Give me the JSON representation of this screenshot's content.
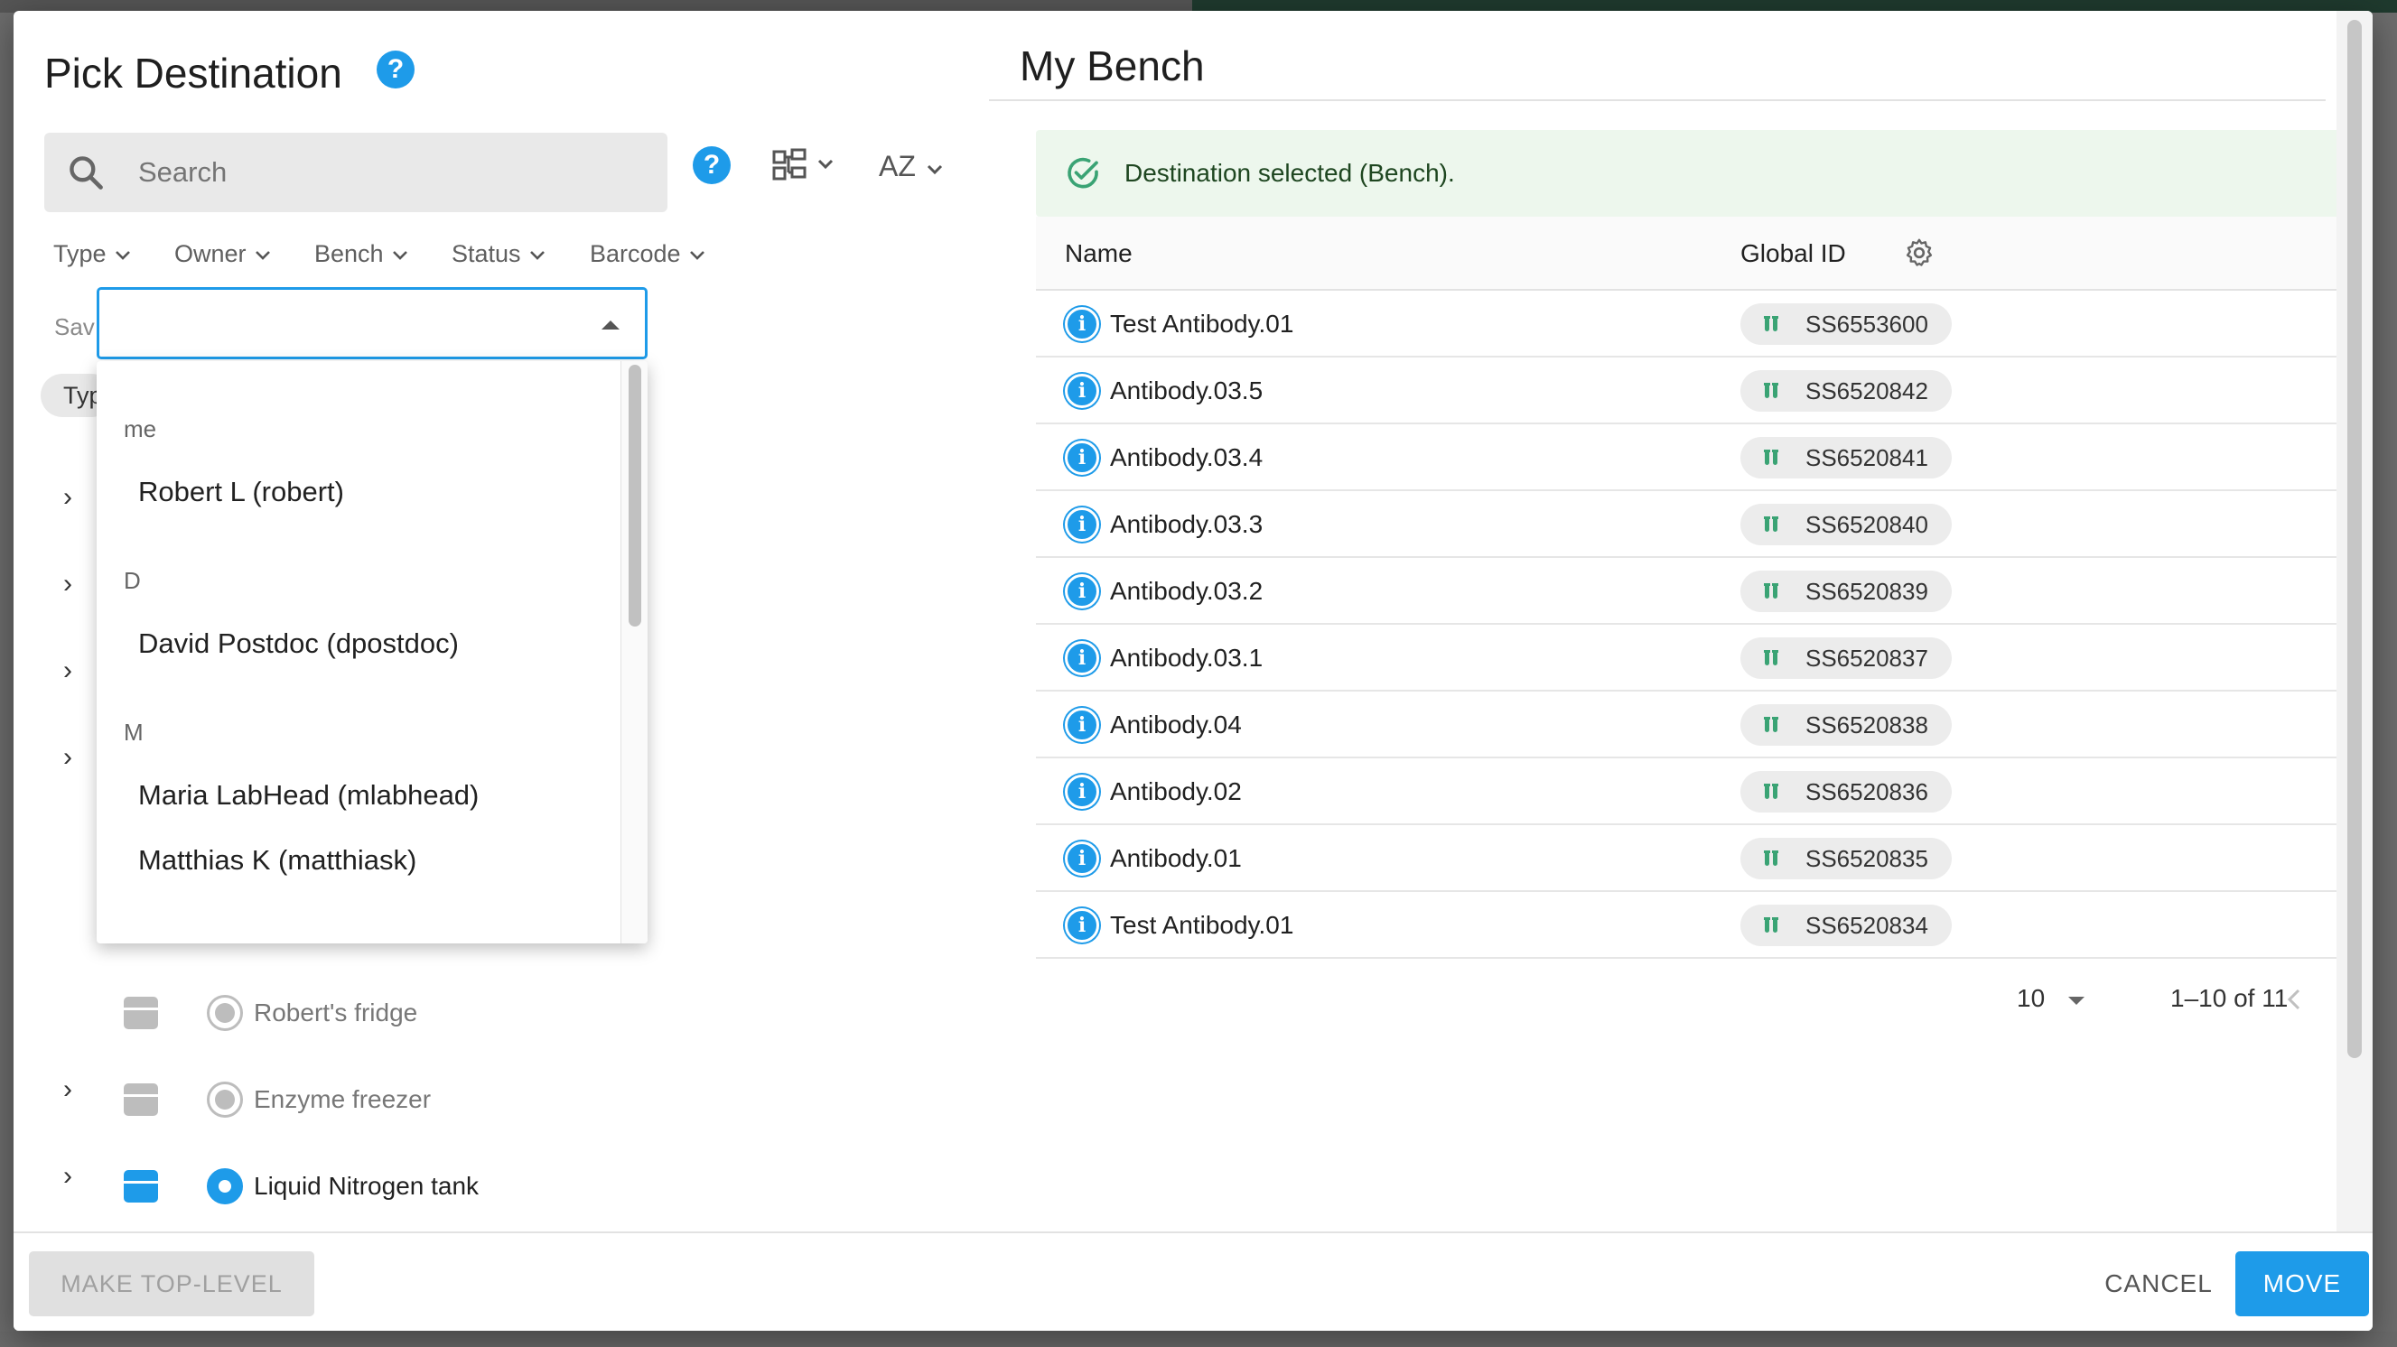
{
  "left": {
    "title": "Pick Destination",
    "help_glyph": "?",
    "search_placeholder": "Search",
    "sort_label": "AZ",
    "filters": [
      "Type",
      "Owner",
      "Bench",
      "Status",
      "Barcode"
    ],
    "saved_label": "Sav",
    "type_chip": "Typ",
    "tree": [
      {
        "label": "Robert's fridge",
        "expandable": false,
        "active": false
      },
      {
        "label": "Enzyme freezer",
        "expandable": true,
        "active": false
      },
      {
        "label": "Liquid Nitrogen tank",
        "expandable": true,
        "active": true
      }
    ]
  },
  "owner_dropdown": {
    "input_value": "",
    "groups": [
      {
        "header": "me",
        "items": [
          "Robert L (robert)"
        ]
      },
      {
        "header": "D",
        "items": [
          "David Postdoc (dpostdoc)"
        ]
      },
      {
        "header": "M",
        "items": [
          "Maria LabHead (mlabhead)",
          "Matthias K (matthiask)"
        ]
      }
    ]
  },
  "right": {
    "title": "My Bench",
    "alert": "Destination selected (Bench).",
    "columns": {
      "name": "Name",
      "global_id": "Global ID"
    },
    "rows": [
      {
        "name": "Test Antibody.01",
        "global_id": "SS6553600"
      },
      {
        "name": "Antibody.03.5",
        "global_id": "SS6520842"
      },
      {
        "name": "Antibody.03.4",
        "global_id": "SS6520841"
      },
      {
        "name": "Antibody.03.3",
        "global_id": "SS6520840"
      },
      {
        "name": "Antibody.03.2",
        "global_id": "SS6520839"
      },
      {
        "name": "Antibody.03.1",
        "global_id": "SS6520837"
      },
      {
        "name": "Antibody.04",
        "global_id": "SS6520838"
      },
      {
        "name": "Antibody.02",
        "global_id": "SS6520836"
      },
      {
        "name": "Antibody.01",
        "global_id": "SS6520835"
      },
      {
        "name": "Test Antibody.01",
        "global_id": "SS6520834"
      }
    ],
    "pager": {
      "rows_per_page": "10",
      "range": "1–10 of 11"
    }
  },
  "footer": {
    "make_top_level": "MAKE TOP-LEVEL",
    "cancel": "CANCEL",
    "move": "MOVE"
  },
  "colors": {
    "accent": "#1e9be9",
    "success_bg": "#edf7ed",
    "success_text": "#1e4620",
    "tube_green": "#3aa374"
  }
}
